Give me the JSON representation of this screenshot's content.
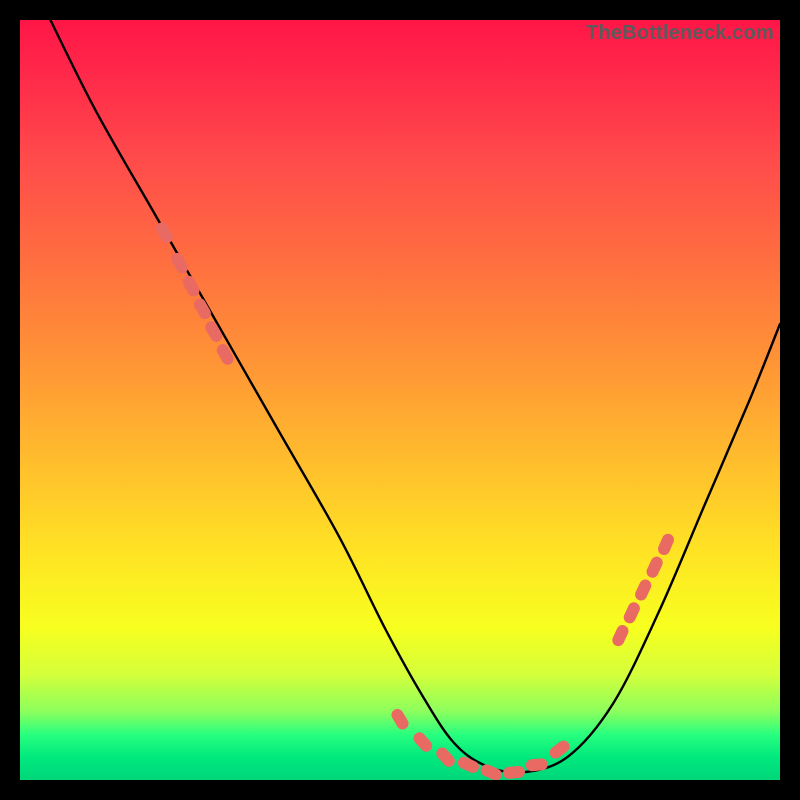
{
  "watermark": "TheBottleneck.com",
  "chart_data": {
    "type": "line",
    "title": "",
    "xlabel": "",
    "ylabel": "",
    "xlim": [
      0,
      100
    ],
    "ylim": [
      0,
      100
    ],
    "grid": false,
    "legend": false,
    "series": [
      {
        "name": "bottleneck-curve",
        "x": [
          4,
          10,
          18,
          26,
          34,
          42,
          48,
          53,
          57,
          61,
          66,
          72,
          78,
          84,
          90,
          96,
          100
        ],
        "y": [
          100,
          88,
          74,
          60,
          46,
          32,
          20,
          11,
          5,
          2,
          1,
          3,
          10,
          22,
          36,
          50,
          60
        ]
      }
    ],
    "markers": {
      "name": "highlighted-points",
      "color": "#e96a62",
      "points": [
        {
          "x": 19,
          "y": 72
        },
        {
          "x": 21,
          "y": 68
        },
        {
          "x": 22.5,
          "y": 65
        },
        {
          "x": 24,
          "y": 62
        },
        {
          "x": 25.5,
          "y": 59
        },
        {
          "x": 27,
          "y": 56
        },
        {
          "x": 50,
          "y": 8
        },
        {
          "x": 53,
          "y": 5
        },
        {
          "x": 56,
          "y": 3
        },
        {
          "x": 59,
          "y": 2
        },
        {
          "x": 62,
          "y": 1
        },
        {
          "x": 65,
          "y": 1
        },
        {
          "x": 68,
          "y": 2
        },
        {
          "x": 71,
          "y": 4
        },
        {
          "x": 79,
          "y": 19
        },
        {
          "x": 80.5,
          "y": 22
        },
        {
          "x": 82,
          "y": 25
        },
        {
          "x": 83.5,
          "y": 28
        },
        {
          "x": 85,
          "y": 31
        }
      ]
    },
    "annotations": []
  }
}
